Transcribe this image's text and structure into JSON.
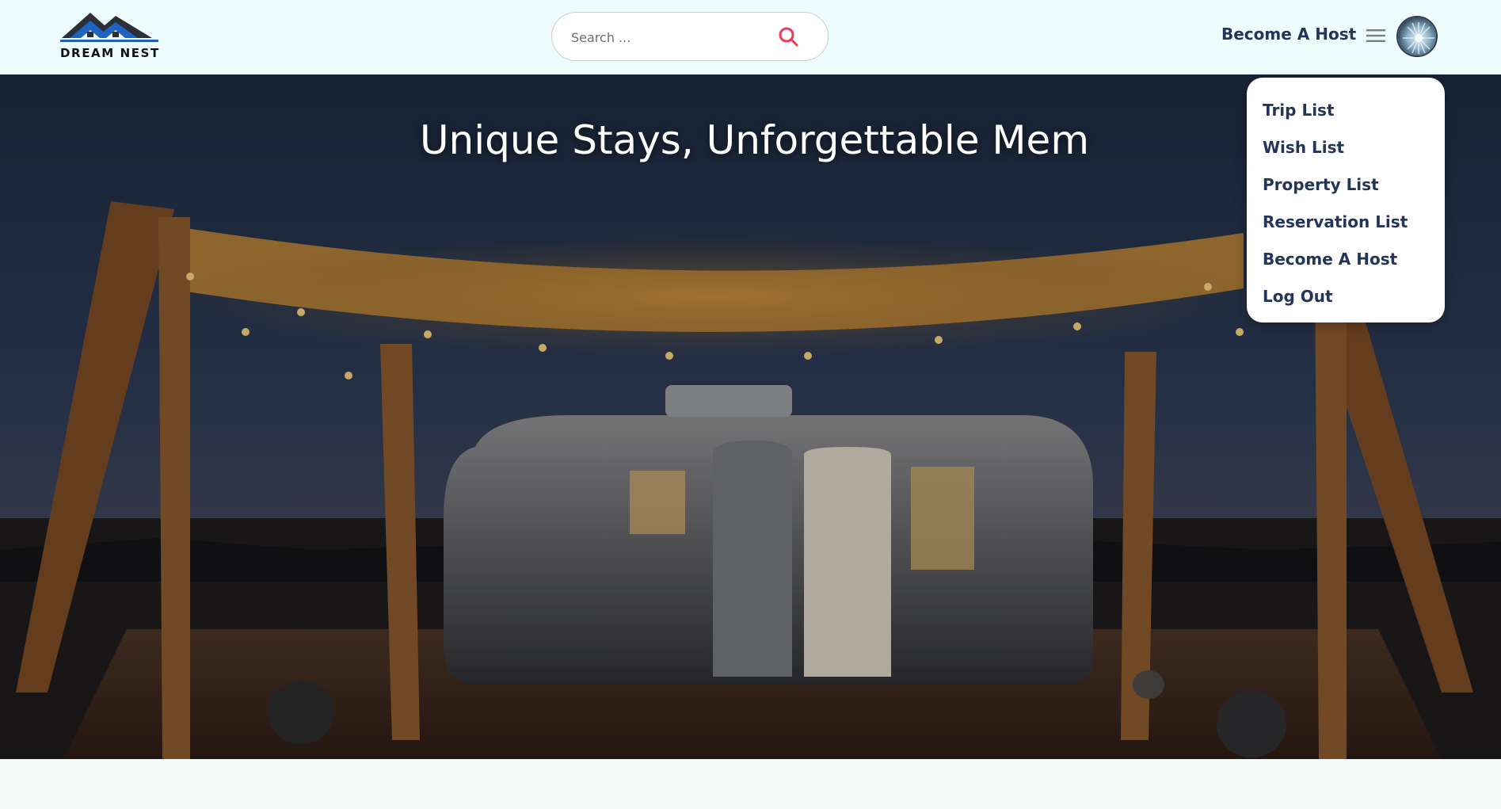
{
  "brand": {
    "name": "DREAM NEST",
    "logo_icon": "house-mountain-icon"
  },
  "search": {
    "placeholder": "Search ...",
    "icon": "search-icon"
  },
  "header": {
    "host_link": "Become A Host",
    "menu_icon": "hamburger-menu-icon",
    "avatar_icon": "user-avatar"
  },
  "hero": {
    "title": "Unique Stays, Unforgettable Mem"
  },
  "dropdown": {
    "items": [
      "Trip List",
      "Wish List",
      "Property List",
      "Reservation List",
      "Become A Host",
      "Log Out"
    ]
  },
  "colors": {
    "accent": "#f2385a",
    "nav_bg": "#effcfd",
    "text_dark": "#24355a"
  }
}
